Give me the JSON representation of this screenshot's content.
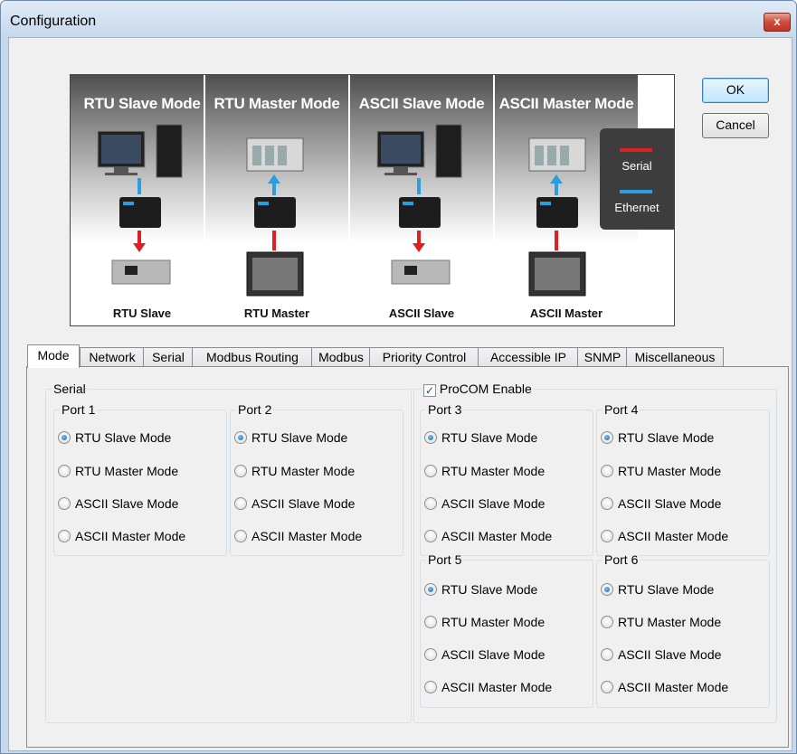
{
  "window": {
    "title": "Configuration",
    "close_glyph": "x"
  },
  "banner": {
    "columns": [
      {
        "heading": "RTU Slave Mode",
        "caption": "RTU Slave"
      },
      {
        "heading": "RTU Master Mode",
        "caption": "RTU Master"
      },
      {
        "heading": "ASCII Slave Mode",
        "caption": "ASCII Slave"
      },
      {
        "heading": "ASCII Master Mode",
        "caption": "ASCII Master"
      }
    ],
    "legend": {
      "serial": "Serial",
      "ethernet": "Ethernet",
      "serial_color": "#e02020",
      "ethernet_color": "#2a9fe0"
    }
  },
  "buttons": {
    "ok": "OK",
    "cancel": "Cancel"
  },
  "tabs": [
    "Mode",
    "Network",
    "Serial",
    "Modbus Routing",
    "Modbus",
    "Priority Control",
    "Accessible IP",
    "SNMP",
    "Miscellaneous"
  ],
  "active_tab": "Mode",
  "mode": {
    "serial_label": "Serial",
    "procom_label": "ProCOM Enable",
    "procom_checked": true,
    "options": [
      "RTU Slave Mode",
      "RTU Master Mode",
      "ASCII Slave Mode",
      "ASCII Master Mode"
    ],
    "ports": [
      {
        "label": "Port 1",
        "selected": "RTU Slave Mode"
      },
      {
        "label": "Port 2",
        "selected": "RTU Slave Mode"
      },
      {
        "label": "Port 3",
        "selected": "RTU Slave Mode"
      },
      {
        "label": "Port 4",
        "selected": "RTU Slave Mode"
      },
      {
        "label": "Port 5",
        "selected": "RTU Slave Mode"
      },
      {
        "label": "Port 6",
        "selected": "RTU Slave Mode"
      }
    ]
  }
}
